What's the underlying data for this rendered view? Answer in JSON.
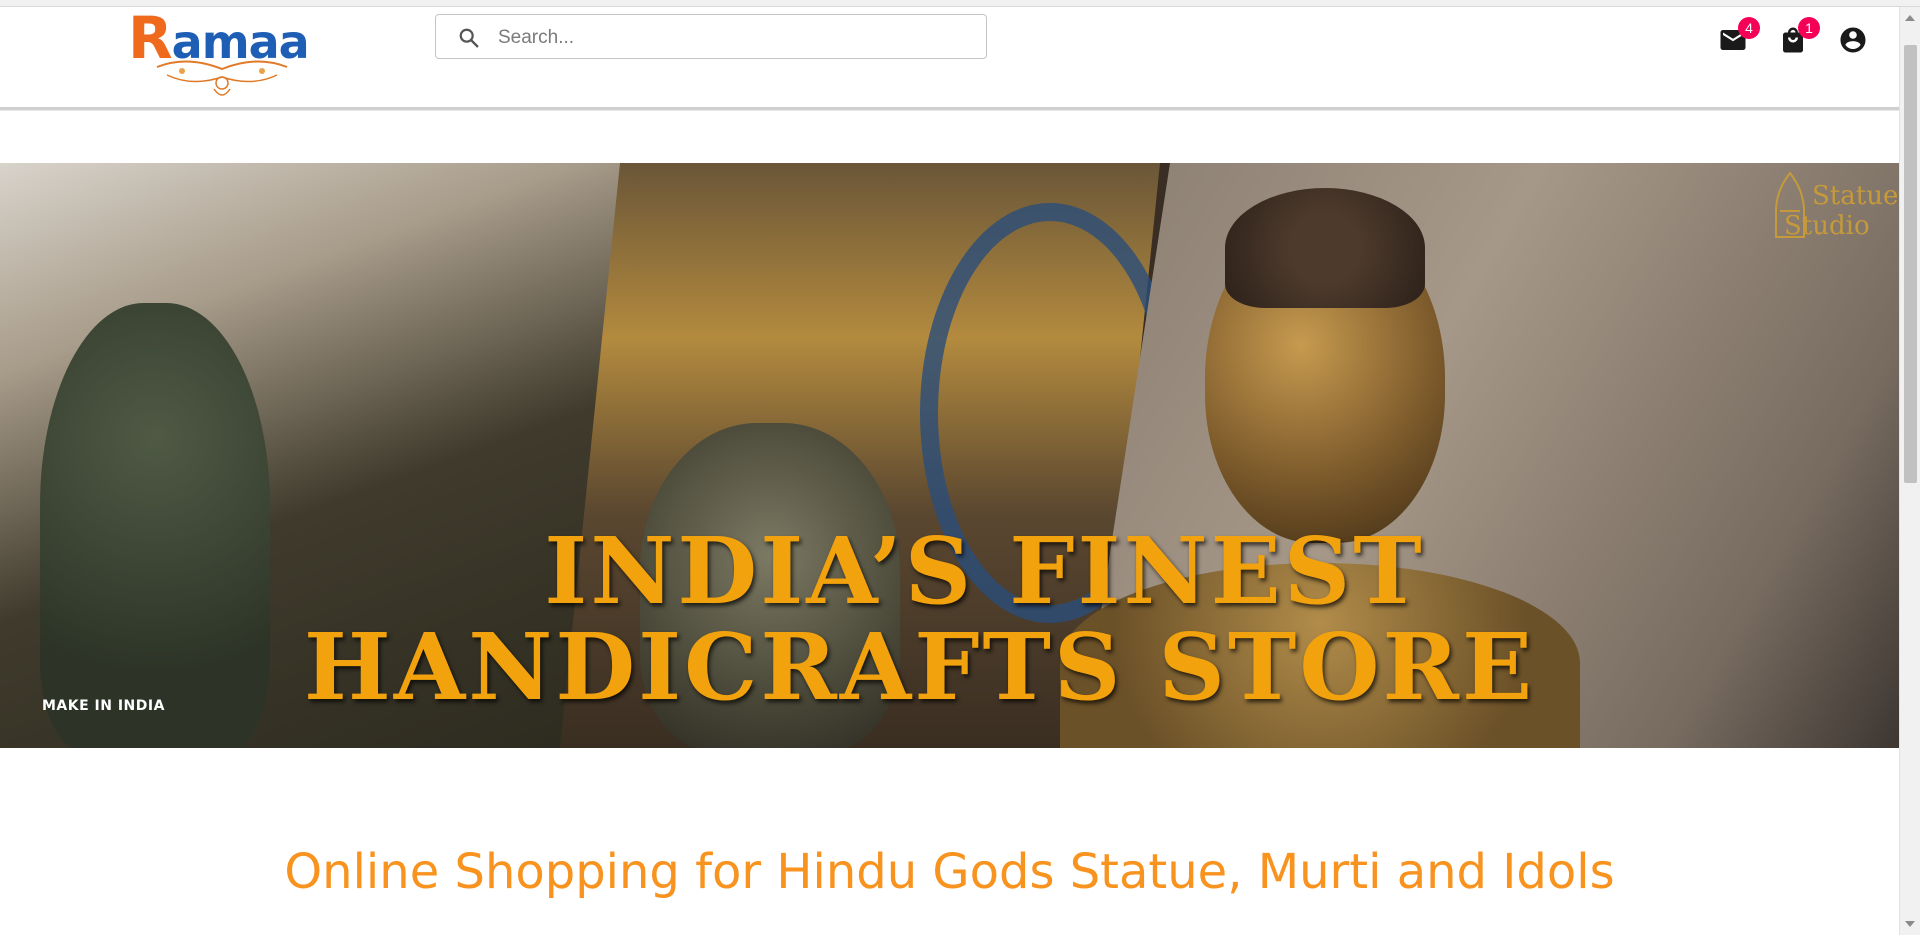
{
  "header": {
    "logo": {
      "text_first": "R",
      "text_rest": "amaa",
      "colors": {
        "primary": "#f06a1d",
        "secondary": "#1e5eb5"
      }
    },
    "search": {
      "placeholder": "Search...",
      "value": ""
    },
    "icons": {
      "messages": {
        "icon": "mail-icon",
        "badge": "4"
      },
      "cart": {
        "icon": "shopping-bag-icon",
        "badge": "1"
      },
      "account": {
        "icon": "account-circle-icon"
      }
    },
    "badge_color": "#f50057"
  },
  "hero": {
    "headline_line_1": "INDIA’S FINEST",
    "headline_line_2": "HANDICRAFTS STORE",
    "make_in_india": "MAKE IN INDIA",
    "brand_line_1": "Statue",
    "brand_line_2": "Studio",
    "headline_color": "#f2a20d"
  },
  "tagline": {
    "text": "Online Shopping for Hindu Gods Statue, Murti and Idols",
    "color": "#f7931e"
  }
}
